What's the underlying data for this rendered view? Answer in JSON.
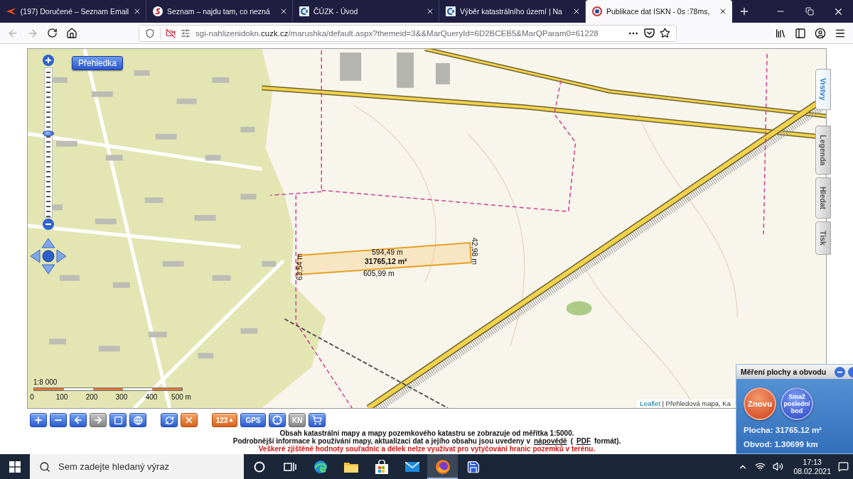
{
  "browser": {
    "tabs": [
      {
        "title": "(197) Doručené – Seznam Email",
        "selected": false
      },
      {
        "title": "Seznam – najdu tam, co nezná",
        "selected": false
      },
      {
        "title": "ČÚZK - Úvod",
        "selected": false
      },
      {
        "title": "Výběr katastrálního území | Na",
        "selected": false
      },
      {
        "title": "Publikace dat ISKN - 0s :78ms,",
        "selected": true
      }
    ],
    "address": "sgi-nahlizenidokn.**cuzk.cz**/marushka/default.aspx?themeid=3&&MarQueryId=6D2BCEB5&MarQParam0=61228"
  },
  "map": {
    "overview_button": "Přehledka",
    "zoom": {
      "level": 0.56
    },
    "side_tabs": [
      {
        "label": "Vrstvy",
        "selected": true
      },
      {
        "label": "Legenda",
        "selected": false
      },
      {
        "label": "Hledat",
        "selected": false
      },
      {
        "label": "Tisk",
        "selected": false
      }
    ],
    "measurement_labels": [
      {
        "kind": "along",
        "text": "594,49 m"
      },
      {
        "kind": "area",
        "text": "31765,12 m²"
      },
      {
        "kind": "along",
        "text": "605,99 m"
      },
      {
        "kind": "up",
        "text": "63,54 m"
      },
      {
        "kind": "down",
        "text": "42,98 m"
      }
    ],
    "scale": {
      "ratio": "1:8 000",
      "ticks": [
        "0",
        "100",
        "200",
        "300",
        "400",
        "500 m"
      ]
    },
    "attribution": {
      "link": "Leaflet",
      "text": "| Přehledová mapa, Ka"
    }
  },
  "toolbar": {
    "groups": [
      {
        "buttons": [
          {
            "disabled": false
          },
          {
            "disabled": false
          },
          {
            "disabled": false
          },
          {
            "disabled": true
          },
          {
            "disabled": false
          },
          {
            "disabled": false
          }
        ]
      },
      {
        "buttons": [
          {
            "disabled": false
          },
          {
            "disabled": false
          }
        ]
      },
      {
        "buttons": [
          {
            "label": "123",
            "disabled": false
          },
          {
            "label": "GPS",
            "disabled": false
          },
          {
            "disabled": false
          },
          {
            "label": "KN",
            "disabled": true
          },
          {
            "disabled": false
          }
        ]
      }
    ]
  },
  "notes": [
    {
      "kind": "plain",
      "text": "Obsah katastrální mapy a mapy pozemkového katastru se zobrazuje od měřítka 1:5000."
    },
    {
      "kind": "help",
      "text": "Podrobnější informace k používání mapy, aktualizaci dat a jejího obsahu jsou uvedeny v",
      "link": "nápovědě",
      "after": "(",
      "link_2": "PDF",
      "end": "formát)."
    },
    {
      "kind": "warning",
      "text": "Veškeré zjištěné hodnoty souřadnic a délek nelze využívat pro vytyčování hranic pozemků v terénu."
    }
  ],
  "measure_panel": {
    "title": "Měření plochy a obvodu",
    "buttons": [
      "Znovu",
      "Smaž poslední bod"
    ],
    "area": "Plocha: 31765.12 m²",
    "perimeter": "Obvod: 1.30699 km"
  },
  "taskbar": {
    "search": {
      "placeholder": "Sem zadejte hledaný výraz"
    },
    "apps": [
      {
        "selected": false
      },
      {
        "selected": false
      },
      {
        "selected": false
      },
      {
        "selected": false
      },
      {
        "selected": false
      },
      {
        "selected": false
      },
      {
        "selected": true
      },
      {
        "selected": false
      }
    ],
    "time": "17:13",
    "date": "08.02.2021"
  }
}
